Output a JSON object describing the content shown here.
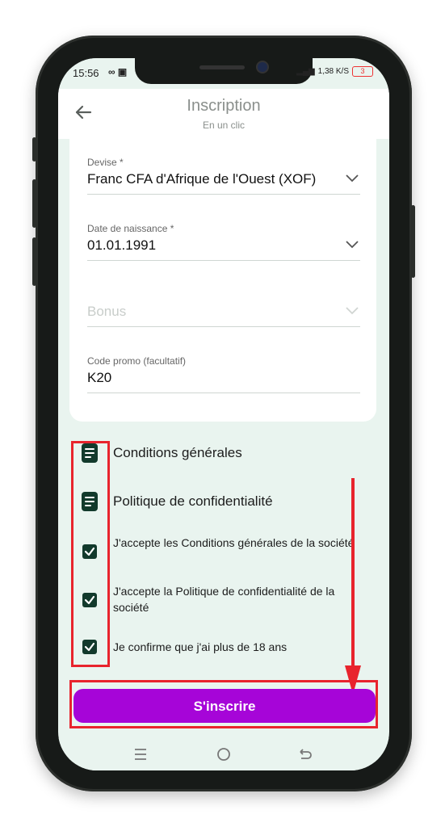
{
  "status": {
    "time": "15:56",
    "left_icons": "∞ ▣",
    "network_speed": "1,38 K/S",
    "battery": "3"
  },
  "header": {
    "back_icon": "arrow-left-icon",
    "title": "Inscription",
    "subtitle": "En un clic"
  },
  "form": {
    "currency": {
      "label": "Devise *",
      "value": "Franc CFA d'Afrique de l'Ouest (XOF)"
    },
    "birthdate": {
      "label": "Date de naissance *",
      "value": "01.01.1991"
    },
    "bonus": {
      "placeholder": "Bonus"
    },
    "promo": {
      "label": "Code promo (facultatif)",
      "value": "K20"
    }
  },
  "documents": [
    {
      "label": "Conditions générales",
      "icon": "document-icon"
    },
    {
      "label": "Politique de confidentialité",
      "icon": "document-icon"
    }
  ],
  "checkboxes": [
    {
      "label": "J'accepte les Conditions générales de la société",
      "checked": true
    },
    {
      "label": "J'accepte la Politique de confidentialité de la société",
      "checked": true
    },
    {
      "label": "Je confirme que j'ai plus de 18 ans",
      "checked": true
    }
  ],
  "submit": {
    "label": "S'inscrire"
  },
  "colors": {
    "accent": "#a605d8",
    "checkbox": "#123a2c",
    "highlight": "#e8242d",
    "background": "#e9f4ef"
  },
  "navbar": {
    "icons": [
      "menu-icon",
      "home-circle-icon",
      "back-curve-icon"
    ]
  }
}
